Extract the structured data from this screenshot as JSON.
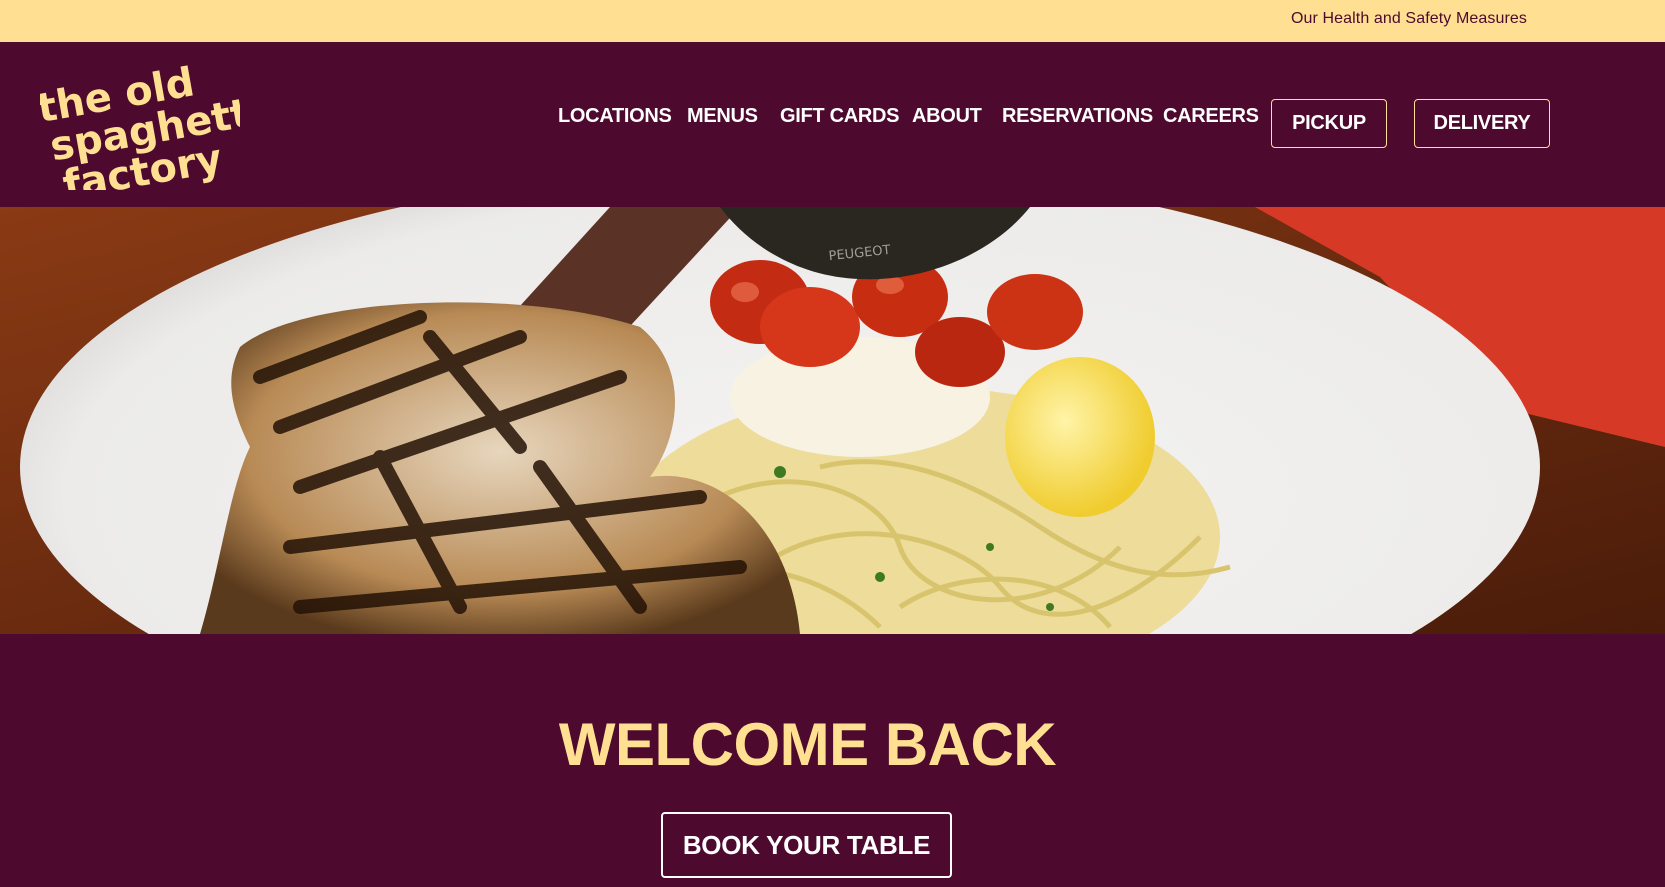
{
  "topbar": {
    "link": "Our Health and Safety Measures"
  },
  "logo": {
    "lines": [
      "the old",
      "spaghetti",
      "factory"
    ]
  },
  "nav": {
    "items": [
      "LOCATIONS",
      "MENUS",
      "GIFT CARDS",
      "ABOUT",
      "RESERVATIONS",
      "CAREERS"
    ],
    "pickup": "PICKUP",
    "delivery": "DELIVERY"
  },
  "hero": {
    "grinder_brand": "PEUGEOT"
  },
  "welcome": {
    "heading": "WELCOME BACK",
    "cta": "BOOK YOUR TABLE"
  },
  "colors": {
    "brand_maroon": "#4d0a2e",
    "brand_cream": "#ffdf91",
    "white": "#ffffff"
  }
}
